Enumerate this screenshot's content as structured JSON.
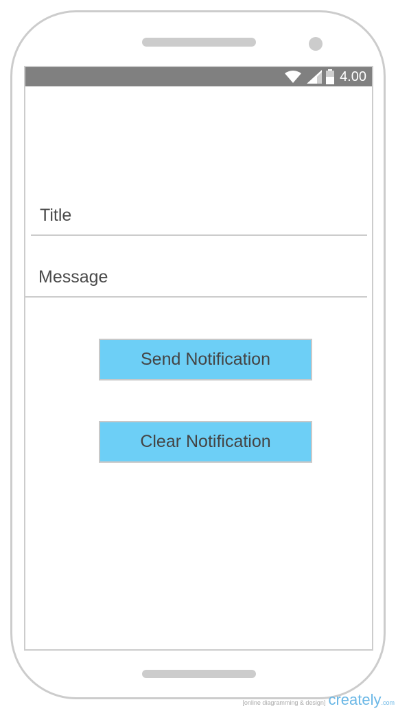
{
  "status_bar": {
    "time": "4.00",
    "icons": [
      "wifi-icon",
      "signal-icon",
      "battery-icon"
    ],
    "background": "#808080"
  },
  "form": {
    "title_placeholder": "Title",
    "message_placeholder": "Message"
  },
  "buttons": {
    "send_label": "Send Notification",
    "clear_label": "Clear Notification",
    "color": "#6dcff6"
  },
  "watermark": {
    "tagline": "[online diagramming & design]",
    "brand": "creately",
    "suffix": ".com"
  }
}
